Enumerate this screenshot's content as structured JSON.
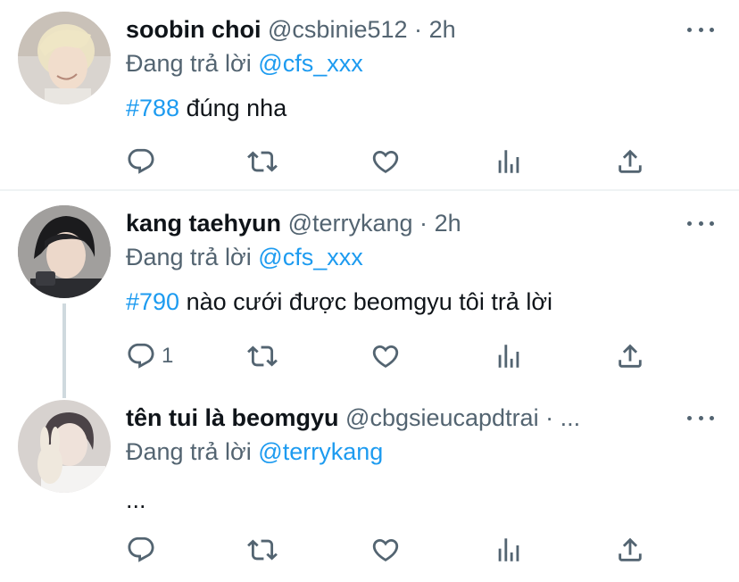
{
  "tweets": [
    {
      "name": "soobin choi",
      "handle": "@csbinie512",
      "separator": "·",
      "time": "2h",
      "reply_prefix": "Đang trả lời",
      "reply_to": "@cfs_xxx",
      "hashtag": "#788",
      "text": "đúng nha",
      "reply_count": ""
    },
    {
      "name": "kang taehyun",
      "handle": "@terrykang",
      "separator": "·",
      "time": "2h",
      "reply_prefix": "Đang trả lời",
      "reply_to": "@cfs_xxx",
      "hashtag": "#790",
      "text": "nào cưới được beomgyu tôi trả lời",
      "reply_count": "1"
    },
    {
      "name": "tên tui là beomgyu",
      "handle": "@cbgsieucapdtrai",
      "separator": "·",
      "time": "...",
      "reply_prefix": "Đang trả lời",
      "reply_to": "@terrykang",
      "hashtag": "",
      "text": "...",
      "reply_count": ""
    }
  ],
  "icons": {
    "reply": "reply-icon",
    "retweet": "retweet-icon",
    "like": "like-icon",
    "views": "views-icon",
    "share": "share-icon",
    "more": "more-icon"
  },
  "colors": {
    "accent": "#1d9bf0",
    "muted": "#536471",
    "text": "#0f1419",
    "divider": "#eff3f4",
    "thread": "#cfd9de"
  }
}
